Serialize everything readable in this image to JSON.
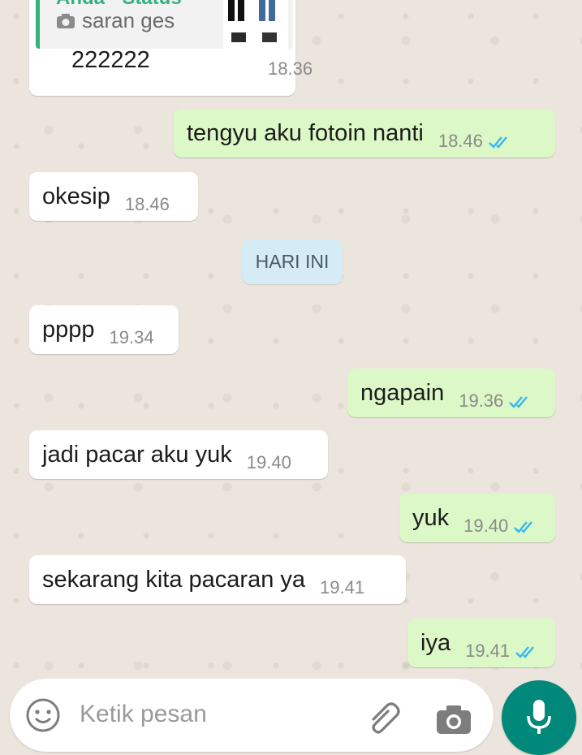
{
  "quoted_message": {
    "author": "Anda · Status",
    "caption": "saran ges",
    "camera_icon": "camera-icon",
    "text": "222222",
    "time": "18.36"
  },
  "messages": [
    {
      "direction": "out",
      "text": "tengyu aku fotoin nanti",
      "time": "18.46",
      "status": "read"
    },
    {
      "direction": "in",
      "text": "okesip",
      "time": "18.46"
    },
    {
      "direction": "in",
      "text": "pppp",
      "time": "19.34"
    },
    {
      "direction": "out",
      "text": "ngapain",
      "time": "19.36",
      "status": "read"
    },
    {
      "direction": "in",
      "text": "jadi pacar aku yuk",
      "time": "19.40"
    },
    {
      "direction": "out",
      "text": "yuk",
      "time": "19.40",
      "status": "read"
    },
    {
      "direction": "in",
      "text": "sekarang kita pacaran ya",
      "time": "19.41"
    },
    {
      "direction": "out",
      "text": "iya",
      "time": "19.41",
      "status": "read"
    }
  ],
  "date_divider": "HARI INI",
  "composer": {
    "placeholder": "Ketik pesan",
    "emoji_icon": "emoji-icon",
    "attach_icon": "paperclip-icon",
    "camera_icon": "camera-icon",
    "mic_icon": "microphone-icon"
  },
  "colors": {
    "background": "#ECE5DD",
    "incoming_bubble": "#FFFFFF",
    "outgoing_bubble": "#DCF8C6",
    "read_tick": "#34B7F1",
    "accent": "#00897B"
  }
}
